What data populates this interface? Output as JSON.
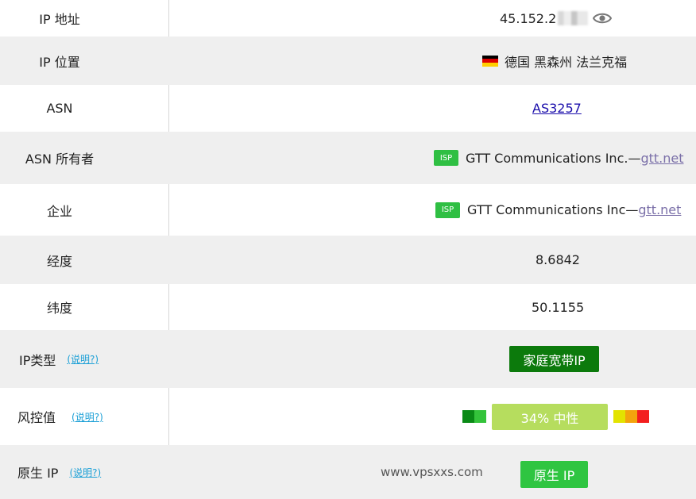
{
  "rows": {
    "ip_address": {
      "label": "IP 地址",
      "value": "45.152.2"
    },
    "ip_location": {
      "label": "IP 位置",
      "value": "德国 黑森州 法兰克福"
    },
    "asn": {
      "label": "ASN",
      "value": "AS3257"
    },
    "asn_owner": {
      "label": "ASN 所有者",
      "badge": "ISP",
      "org": "GTT Communications Inc.—",
      "domain": "gtt.net"
    },
    "enterprise": {
      "label": "企业",
      "badge": "ISP",
      "org": "GTT Communications Inc—",
      "domain": "gtt.net"
    },
    "longitude": {
      "label": "经度",
      "value": "8.6842"
    },
    "latitude": {
      "label": "纬度",
      "value": "50.1155"
    },
    "ip_type": {
      "label": "IP类型",
      "explain": "(说明?)",
      "value": "家庭宽带IP"
    },
    "risk": {
      "label": "风控值",
      "explain": "(说明?)",
      "value": "34%  中性",
      "level": 0.34
    },
    "native_ip": {
      "label": "原生 IP",
      "explain": "(说明?)",
      "watermark": "www.vpsxxs.com",
      "value": "原生 IP"
    }
  },
  "colors": {
    "row_alt": "#efefef",
    "isp_badge": "#2fbf43",
    "ip_type_button": "#0c7a0c",
    "native_button": "#2fc541",
    "risk_label_bg": "#b6dd5e",
    "risk_green_dark": "#0a8a16",
    "risk_green": "#34c33b",
    "risk_yellow": "#e3e300",
    "risk_orange": "#f3a40d",
    "risk_red": "#f31f1f"
  },
  "icons": {
    "eye": "eye-icon",
    "flag": "germany-flag-icon"
  }
}
